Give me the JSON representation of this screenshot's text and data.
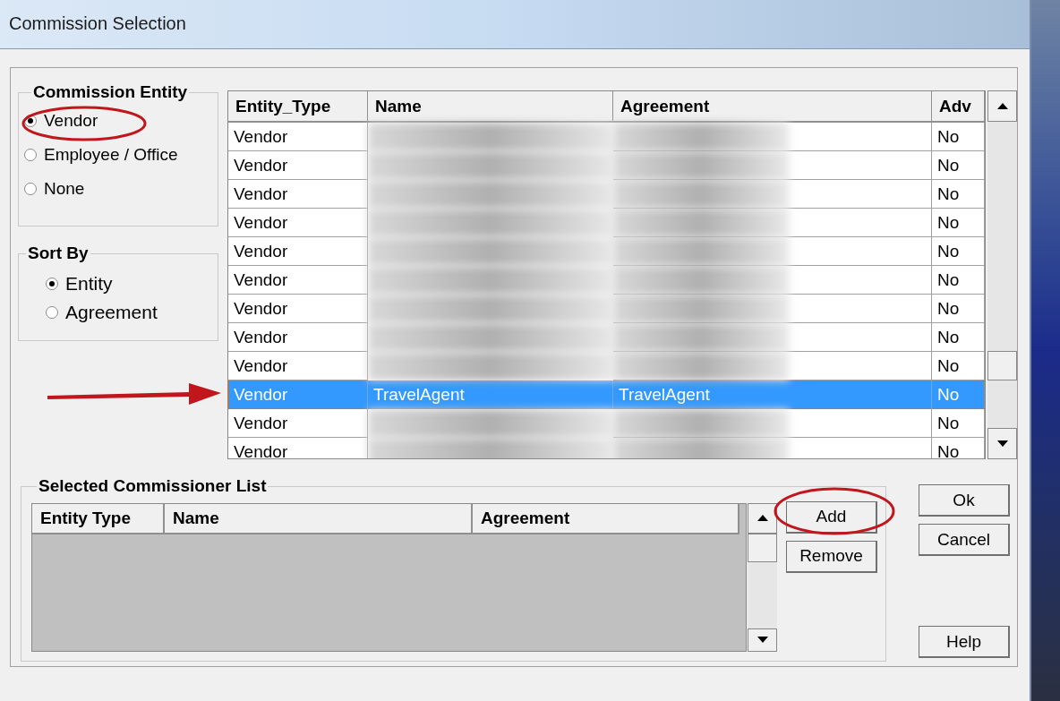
{
  "window": {
    "title": "Commission Selection"
  },
  "commission_entity": {
    "label": "Commission Entity",
    "options": [
      {
        "label": "Vendor",
        "selected": true
      },
      {
        "label": "Employee / Office",
        "selected": false
      },
      {
        "label": "None",
        "selected": false
      }
    ]
  },
  "sort_by": {
    "label": "Sort By",
    "options": [
      {
        "label": "Entity",
        "selected": true
      },
      {
        "label": "Agreement",
        "selected": false
      }
    ]
  },
  "entity_table": {
    "columns": [
      "Entity_Type",
      "Name",
      "Agreement",
      "Adv"
    ],
    "rows": [
      {
        "entity_type": "Vendor",
        "adv": "No",
        "selected": false,
        "redacted": true
      },
      {
        "entity_type": "Vendor",
        "adv": "No",
        "selected": false,
        "redacted": true
      },
      {
        "entity_type": "Vendor",
        "adv": "No",
        "selected": false,
        "redacted": true
      },
      {
        "entity_type": "Vendor",
        "adv": "No",
        "selected": false,
        "redacted": true
      },
      {
        "entity_type": "Vendor",
        "adv": "No",
        "selected": false,
        "redacted": true
      },
      {
        "entity_type": "Vendor",
        "adv": "No",
        "selected": false,
        "redacted": true
      },
      {
        "entity_type": "Vendor",
        "adv": "No",
        "selected": false,
        "redacted": true
      },
      {
        "entity_type": "Vendor",
        "adv": "No",
        "selected": false,
        "redacted": true
      },
      {
        "entity_type": "Vendor",
        "adv": "No",
        "selected": false,
        "redacted": true
      },
      {
        "entity_type": "Vendor",
        "name": "TravelAgent",
        "agreement": "TravelAgent",
        "adv": "No",
        "selected": true
      },
      {
        "entity_type": "Vendor",
        "adv": "No",
        "selected": false,
        "redacted": true
      },
      {
        "entity_type": "Vendor",
        "adv": "No",
        "selected": false,
        "redacted": true
      }
    ]
  },
  "selected_list": {
    "label": "Selected Commissioner List",
    "columns": [
      "Entity Type",
      "Name",
      "Agreement"
    ]
  },
  "list_buttons": [
    "Add",
    "Remove"
  ],
  "dialog_buttons": [
    "Ok",
    "Cancel",
    "Help"
  ]
}
